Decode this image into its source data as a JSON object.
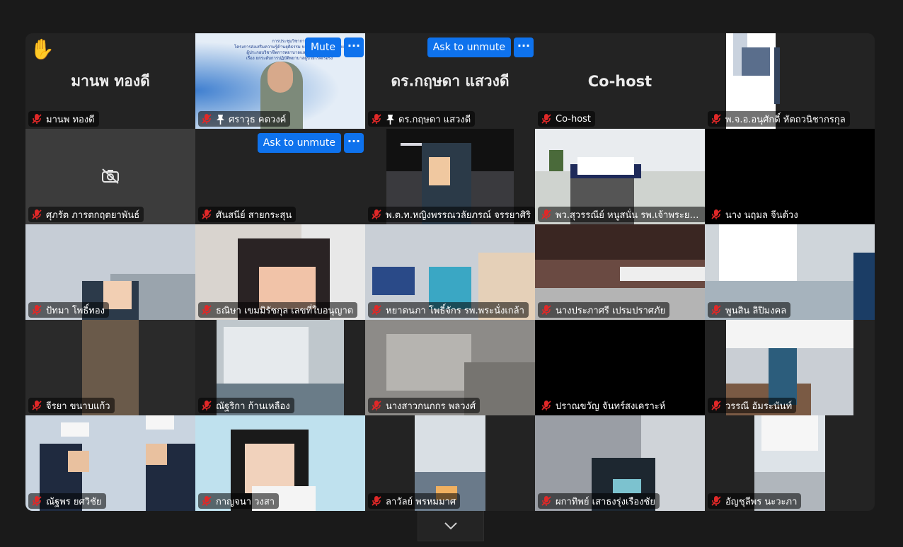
{
  "tiles": [
    {
      "name": "มานพ ทองดี",
      "big": "มานพ ทองดี",
      "hand": true
    },
    {
      "name": "ศราวุธ คตวงค์",
      "pinned": true,
      "speaking": true,
      "buttons": {
        "primary": "Mute",
        "more": "···"
      },
      "slide": [
        "การประชุมวิชาการ",
        "โครงการส่งเสริมความรู้ด้านยุติธรรม หลักธรรม และกฎหมาย",
        "ผู้ประกอบวิชาชีพการพยาบาลและการผดุงครรภ์",
        "เรื่อง ยกระดับการปฏิบัติพยาบาลผู้ป่วยโรคเรื้อรัง"
      ]
    },
    {
      "name": "ดร.กฤษดา แสวงดี",
      "big": "ดร.กฤษดา แสวงดี",
      "pinned": true,
      "buttons": {
        "primary": "Ask to unmute",
        "more": "···"
      }
    },
    {
      "name": "Co-host",
      "big": "Co-host"
    },
    {
      "name": "พ.จ.อ.อนุศักดิ์ หัตถวนิชากรกุล"
    },
    {
      "name": "ศุภรัต ภารตกฤตยาพันธ์",
      "camera_off": true
    },
    {
      "name": "ศันสนีย์ สายกระสุน",
      "buttons": {
        "primary": "Ask to unmute",
        "more": "···"
      }
    },
    {
      "name": "พ.ต.ท.หญิงพรรณวลัยภรณ์ จรรยาศิริ"
    },
    {
      "name": "พว.สุวรรณีย์ หนูสนั่น รพ.เจ้าพระยายมราช"
    },
    {
      "name": "นาง นฤมล จีนด้วง"
    },
    {
      "name": "ปัทมา โพธิ์ทอง"
    },
    {
      "name": "ธณิษา เขมมิรัชกุล เลขที่ใบอนุญาต"
    },
    {
      "name": "หยาดนภา โพธิ์จักร รพ.พระนั่งเกล้า"
    },
    {
      "name": "นางประภาศรี เปรมปราศภัย"
    },
    {
      "name": "พูนสิน ลิปิมงคล"
    },
    {
      "name": "จีรยา ขนาบแก้ว"
    },
    {
      "name": "ณัฐริกา ก้านเหลือง"
    },
    {
      "name": "นางสาวกนกกร พลวงศ์"
    },
    {
      "name": "ปราณขวัญ จันทร์สงเคราะห์"
    },
    {
      "name": "วรรณี อัมระนันท์"
    },
    {
      "name": "ณัฐพร ยศวิชัย"
    },
    {
      "name": "กาญจนา วงสา"
    },
    {
      "name": "ลาวัลย์ พรหมมาศ"
    },
    {
      "name": "ผกาทิพย์ เสาธงรุ่งเรืองชัย"
    },
    {
      "name": "อัญชุลีพร นะวะภา"
    }
  ],
  "colors": {
    "accent": "#0e72ed",
    "speaker_border": "#25d366",
    "muted_icon": "#e02828"
  },
  "icons": {
    "muted": "microphone-muted-icon",
    "pin": "pin-icon",
    "hand": "raise-hand-icon",
    "camera_off": "camera-off-icon",
    "expand": "chevron-down-icon"
  }
}
